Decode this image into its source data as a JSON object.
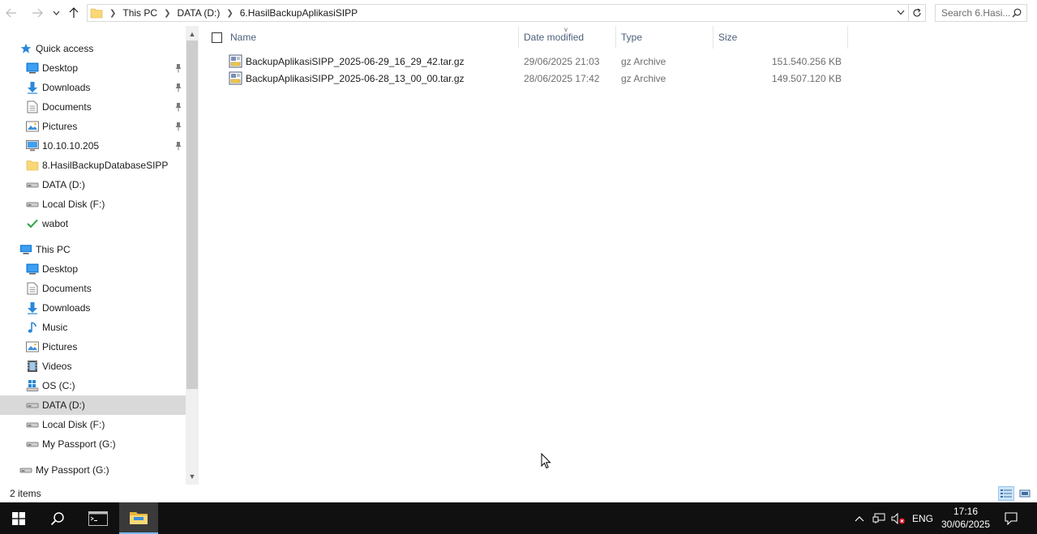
{
  "address_bar": {
    "crumbs": [
      "This PC",
      "DATA (D:)",
      "6.HasilBackupAplikasiSIPP"
    ],
    "search_placeholder": "Search 6.Hasi..."
  },
  "nav": {
    "items": [
      {
        "label": "Quick access",
        "icon": "star-icon",
        "pinned": false
      },
      {
        "label": "Desktop",
        "icon": "desktop-icon",
        "pinned": true
      },
      {
        "label": "Downloads",
        "icon": "download-arrow-icon",
        "pinned": true
      },
      {
        "label": "Documents",
        "icon": "documents-icon",
        "pinned": true
      },
      {
        "label": "Pictures",
        "icon": "pictures-icon",
        "pinned": true
      },
      {
        "label": "10.10.10.205",
        "icon": "network-computer-icon",
        "pinned": true
      },
      {
        "label": "8.HasilBackupDatabaseSIPP",
        "icon": "folder-icon",
        "pinned": false
      },
      {
        "label": "DATA (D:)",
        "icon": "drive-icon",
        "pinned": false
      },
      {
        "label": "Local Disk (F:)",
        "icon": "drive-icon",
        "pinned": false
      },
      {
        "label": "wabot",
        "icon": "green-check-icon",
        "pinned": false
      },
      {
        "label": "This PC",
        "icon": "computer-icon",
        "pinned": false
      },
      {
        "label": "Desktop",
        "icon": "desktop-icon",
        "pinned": false
      },
      {
        "label": "Documents",
        "icon": "documents-icon",
        "pinned": false
      },
      {
        "label": "Downloads",
        "icon": "download-arrow-icon",
        "pinned": false
      },
      {
        "label": "Music",
        "icon": "music-note-icon",
        "pinned": false
      },
      {
        "label": "Pictures",
        "icon": "pictures-icon",
        "pinned": false
      },
      {
        "label": "Videos",
        "icon": "film-icon",
        "pinned": false
      },
      {
        "label": "OS (C:)",
        "icon": "windows-drive-icon",
        "pinned": false
      },
      {
        "label": "DATA (D:)",
        "icon": "drive-icon",
        "pinned": false,
        "selected": true
      },
      {
        "label": "Local Disk (F:)",
        "icon": "drive-icon",
        "pinned": false
      },
      {
        "label": "My Passport (G:)",
        "icon": "drive-icon",
        "pinned": false
      },
      {
        "label": "My Passport (G:)",
        "icon": "drive-icon",
        "pinned": false
      }
    ]
  },
  "columns": {
    "name": "Name",
    "date": "Date modified",
    "type": "Type",
    "size": "Size"
  },
  "files": [
    {
      "name": "BackupAplikasiSIPP_2025-06-29_16_29_42.tar.gz",
      "date": "29/06/2025 21:03",
      "type": "gz Archive",
      "size": "151.540.256 KB"
    },
    {
      "name": "BackupAplikasiSIPP_2025-06-28_13_00_00.tar.gz",
      "date": "28/06/2025 17:42",
      "type": "gz Archive",
      "size": "149.507.120 KB"
    }
  ],
  "status": {
    "count": "2 items"
  },
  "taskbar": {
    "lang": "ENG",
    "time": "17:16",
    "date": "30/06/2025"
  },
  "colors": {
    "accent": "#0078d7",
    "selection": "#d9d9d9",
    "taskbar": "#101010"
  }
}
